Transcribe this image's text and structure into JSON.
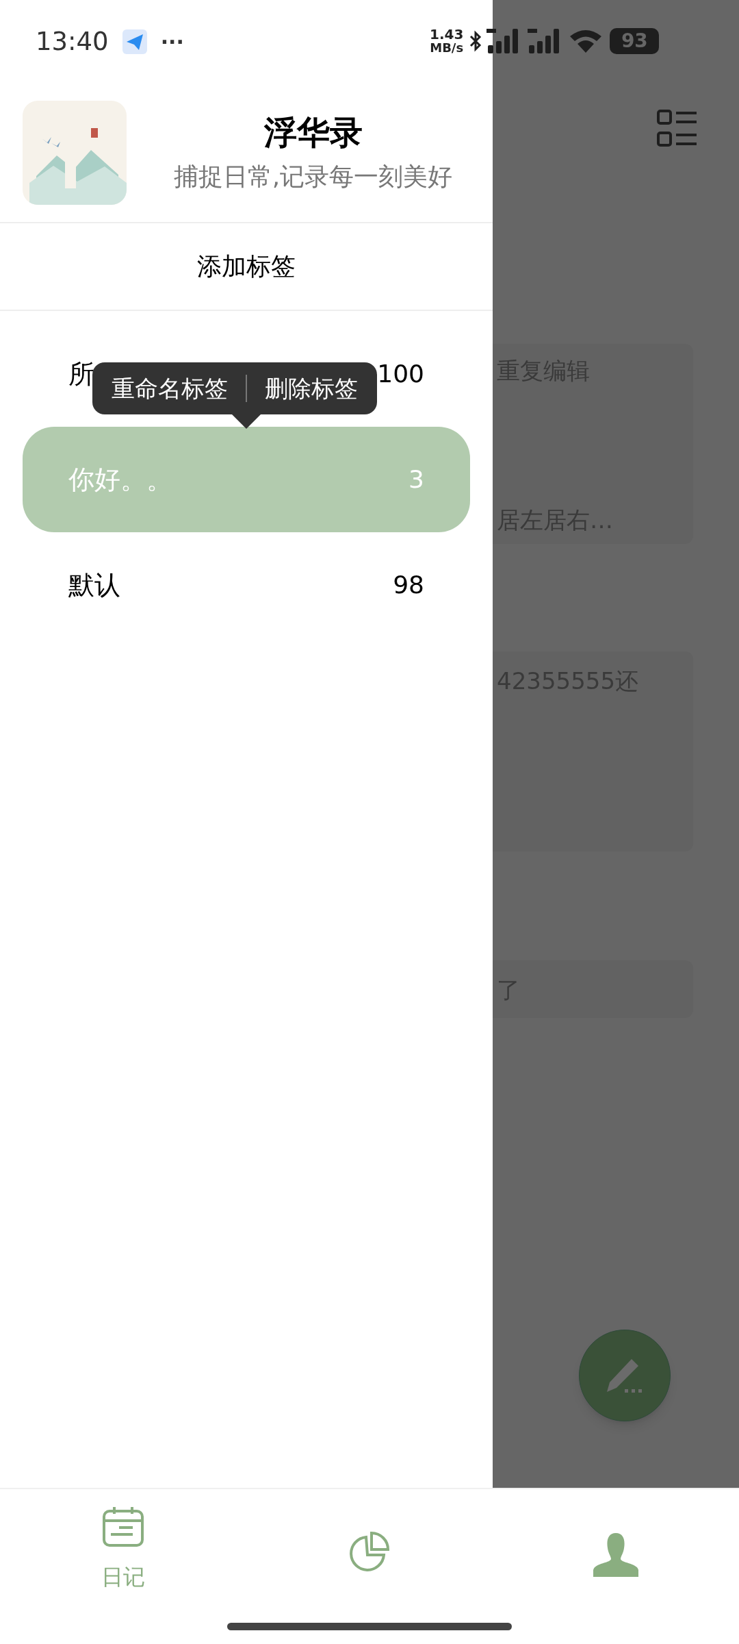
{
  "status_bar": {
    "time": "13:40",
    "more": "···",
    "speed": "1.43",
    "speed_unit": "MB/s",
    "battery": "93"
  },
  "drawer": {
    "app_title": "浮华录",
    "tagline": "捕捉日常,记录每一刻美好",
    "add_tag": "添加标签",
    "tags": [
      {
        "name": "所",
        "count": "100",
        "selected": false
      },
      {
        "name": "你好。。",
        "count": "3",
        "selected": true
      },
      {
        "name": "默认",
        "count": "98",
        "selected": false
      }
    ],
    "context_menu": [
      "重命名标签",
      "删除标签"
    ]
  },
  "background": {
    "cards": [
      {
        "lines": [
          "重复编辑",
          "居左居右…"
        ]
      },
      {
        "lines": [
          "42355555还"
        ]
      },
      {
        "lines": [
          "了"
        ]
      }
    ]
  },
  "bottom_nav": [
    {
      "kind": "calendar",
      "label": "日记",
      "selected": true
    },
    {
      "kind": "chart",
      "selected": false
    },
    {
      "kind": "person",
      "selected": false
    }
  ]
}
